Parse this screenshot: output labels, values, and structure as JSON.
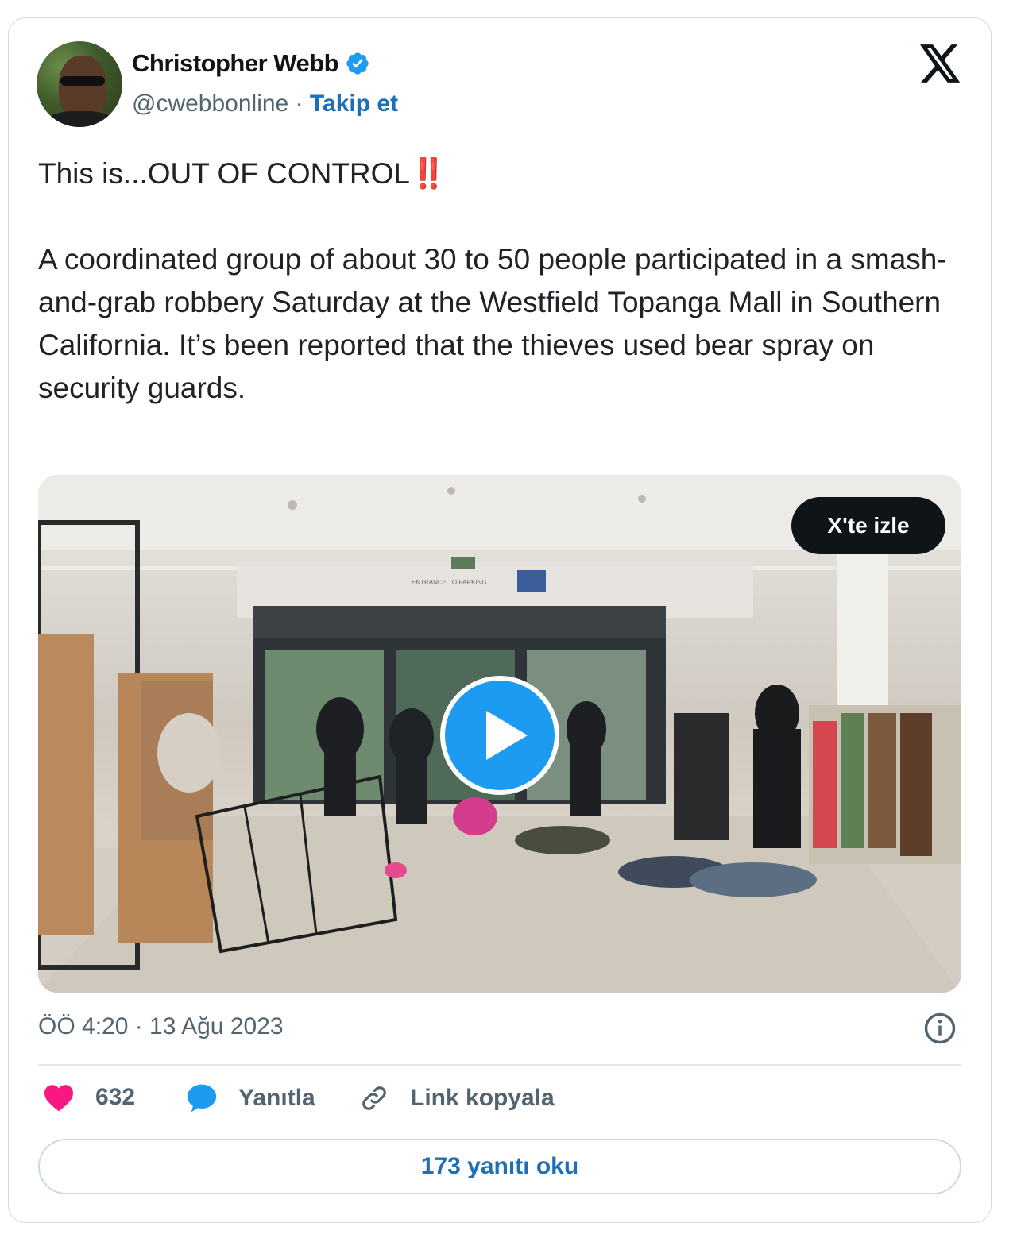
{
  "author": {
    "name": "Christopher Webb",
    "handle": "@cwebbonline",
    "separator": " · ",
    "follow_label": "Takip et",
    "verified_icon": "verified-badge-icon"
  },
  "platform_icon": "x-logo-icon",
  "tweet": {
    "headline": "This is...OUT OF CONTROL",
    "headline_emoji": "‼️",
    "body": "A coordinated group of about 30 to 50 people participated in a smash-and-grab robbery Saturday at the Westfield Topanga Mall in Southern California. It’s been reported that the thieves used bear spray on security guards."
  },
  "media": {
    "watch_label": "X'te izle",
    "play_icon": "play-icon",
    "sign_text": "ENTRANCE TO PARKING"
  },
  "meta": {
    "timestamp": "ÖÖ 4:20 · 13 Ağu 2023",
    "info_icon": "info-icon"
  },
  "actions": {
    "like_count": "632",
    "reply_label": "Yanıtla",
    "copy_link_label": "Link kopyala"
  },
  "read_replies_label": "173 yanıtı oku",
  "colors": {
    "accent": "#1d9bf0",
    "link": "#1d6fb8",
    "heart": "#f91880",
    "muted": "#536471"
  }
}
